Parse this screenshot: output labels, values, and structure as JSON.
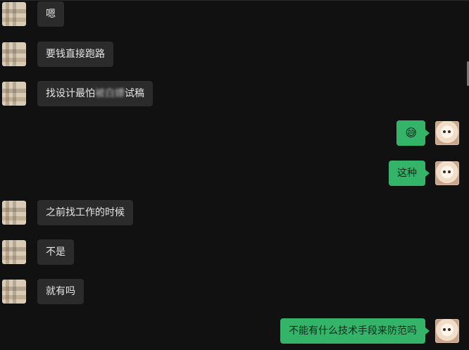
{
  "messages": [
    {
      "side": "left",
      "text": "嗯"
    },
    {
      "side": "left",
      "text": "要钱直接跑路"
    },
    {
      "side": "left",
      "text": "找设计最怕",
      "blurred": "被白嫖",
      "text_tail": "试稿"
    },
    {
      "side": "right",
      "text": "😅"
    },
    {
      "side": "right",
      "text": "这种"
    },
    {
      "side": "left",
      "text": "之前找工作的时候"
    },
    {
      "side": "left",
      "text": "不是"
    },
    {
      "side": "left",
      "text": "就有吗"
    },
    {
      "side": "right",
      "text": "不能有什么技术手段来防范吗"
    }
  ]
}
